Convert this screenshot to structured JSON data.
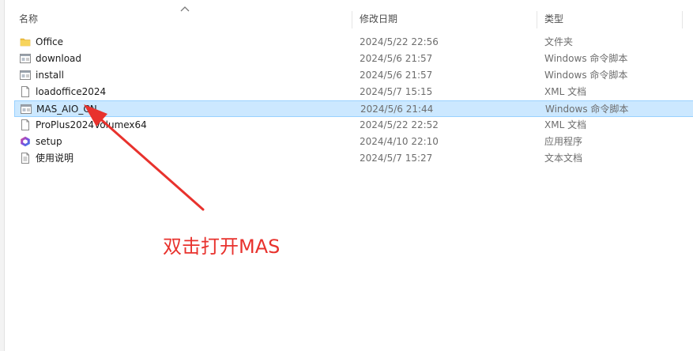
{
  "header": {
    "col_name": "名称",
    "col_date": "修改日期",
    "col_type": "类型"
  },
  "files": [
    {
      "name": "Office",
      "date": "2024/5/22 22:56",
      "type": "文件夹",
      "icon": "folder-icon",
      "selected": false
    },
    {
      "name": "download",
      "date": "2024/5/6 21:57",
      "type": "Windows 命令脚本",
      "icon": "script-icon",
      "selected": false
    },
    {
      "name": "install",
      "date": "2024/5/6 21:57",
      "type": "Windows 命令脚本",
      "icon": "script-icon",
      "selected": false
    },
    {
      "name": "loadoffice2024",
      "date": "2024/5/7 15:15",
      "type": "XML 文档",
      "icon": "document-icon",
      "selected": false
    },
    {
      "name": "MAS_AIO_CN",
      "date": "2024/5/6 21:44",
      "type": "Windows 命令脚本",
      "icon": "script-icon",
      "selected": true
    },
    {
      "name": "ProPlus2024Volumex64",
      "date": "2024/5/22 22:52",
      "type": "XML 文档",
      "icon": "document-icon",
      "selected": false
    },
    {
      "name": "setup",
      "date": "2024/4/10 22:10",
      "type": "应用程序",
      "icon": "office-setup-icon",
      "selected": false
    },
    {
      "name": "使用说明",
      "date": "2024/5/7 15:27",
      "type": "文本文档",
      "icon": "document-icon",
      "selected": false
    }
  ],
  "annotation": {
    "text": "双击打开MAS",
    "color": "#e8322d"
  },
  "colors": {
    "selection_bg": "#cce8ff",
    "selection_border": "#99d1ff",
    "folder": "#f0c040"
  }
}
